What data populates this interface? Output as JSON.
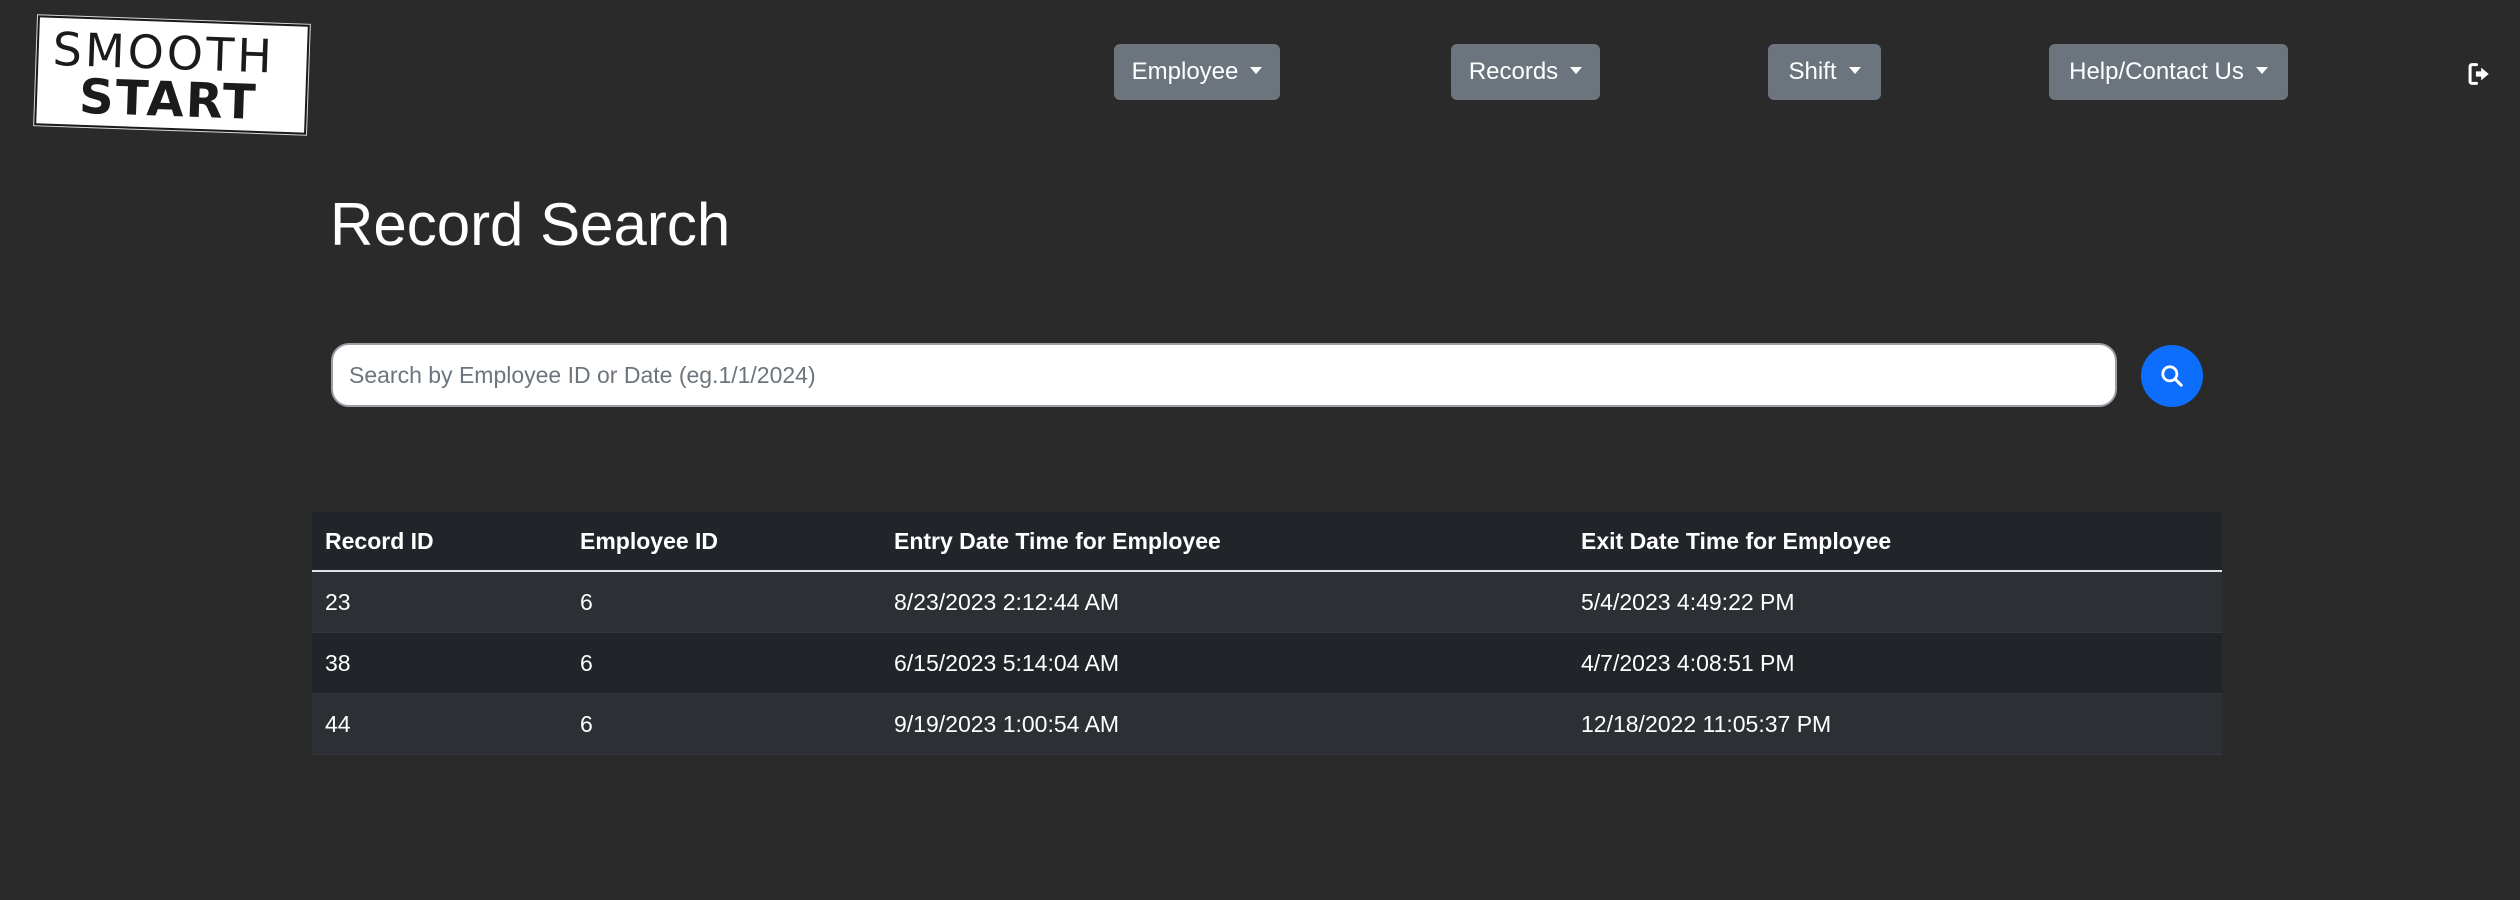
{
  "logo": {
    "line1": "SMOOTH",
    "line2": "START"
  },
  "nav": {
    "employee": "Employee",
    "records": "Records",
    "shift": "Shift",
    "help": "Help/Contact Us",
    "logout_icon": "sign-out-icon"
  },
  "page": {
    "title": "Record Search"
  },
  "search": {
    "placeholder": "Search by Employee ID or Date (eg.1/1/2024)",
    "value": "",
    "button_icon": "search-icon"
  },
  "table": {
    "headers": [
      "Record ID",
      "Employee ID",
      "Entry Date Time for Employee",
      "Exit Date Time for Employee"
    ],
    "rows": [
      [
        "23",
        "6",
        "8/23/2023 2:12:44 AM",
        "5/4/2023 4:49:22 PM"
      ],
      [
        "38",
        "6",
        "6/15/2023 5:14:04 AM",
        "4/7/2023 4:08:51 PM"
      ],
      [
        "44",
        "6",
        "9/19/2023 1:00:54 AM",
        "12/18/2022 11:05:37 PM"
      ]
    ]
  },
  "colors": {
    "background": "#2a2a2b",
    "nav_button": "#6c757d",
    "search_button": "#0d6efd",
    "table_header": "#212529",
    "table_row_odd": "#2c3034",
    "table_row_even": "#212529"
  }
}
